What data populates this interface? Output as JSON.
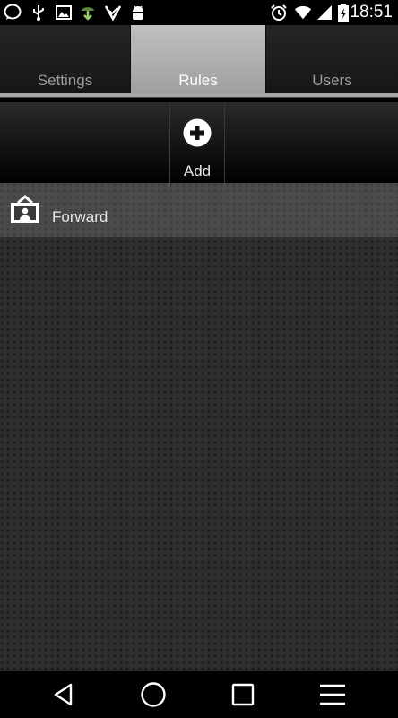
{
  "status_bar": {
    "time": "18:51",
    "icons": [
      "chat-bubble-icon",
      "usb-icon",
      "image-icon",
      "download-icon",
      "check-icon",
      "android-debug-icon",
      "alarm-icon",
      "wifi-icon",
      "signal-icon",
      "battery-icon"
    ]
  },
  "tabs": [
    {
      "label": "Settings",
      "active": false
    },
    {
      "label": "Rules",
      "active": true
    },
    {
      "label": "Users",
      "active": false
    }
  ],
  "toolbar": {
    "add_label": "Add"
  },
  "rules": {
    "items": [
      {
        "label": "Forward",
        "icon": "forward-rule-icon"
      }
    ]
  },
  "nav_bar": {
    "buttons": [
      "back-icon",
      "home-icon",
      "recents-icon",
      "menu-icon"
    ]
  },
  "colors": {
    "active_tab": "#b0b0b0",
    "inactive_tab_text": "#9a9a9a",
    "list_item_bg": "#4b4b4b",
    "content_bg": "#2e2e2e"
  }
}
